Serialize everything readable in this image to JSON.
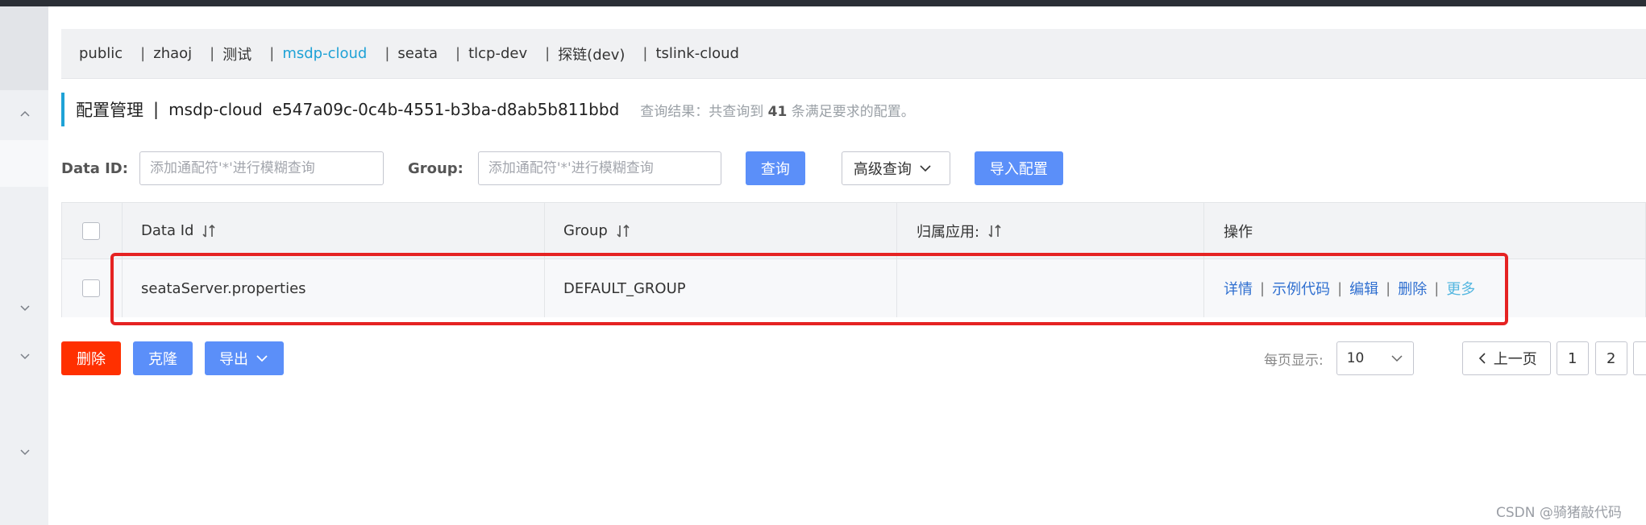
{
  "namespaces": [
    {
      "label": "public",
      "active": false
    },
    {
      "label": "zhaoj",
      "active": false
    },
    {
      "label": "测试",
      "active": false
    },
    {
      "label": "msdp-cloud",
      "active": true
    },
    {
      "label": "seata",
      "active": false
    },
    {
      "label": "tlcp-dev",
      "active": false
    },
    {
      "label": "探链(dev)",
      "active": false
    },
    {
      "label": "tslink-cloud",
      "active": false
    }
  ],
  "namespace_separator": "|",
  "header": {
    "title": "配置管理",
    "separator": "|",
    "namespace_name": "msdp-cloud",
    "namespace_id": "e547a09c-0c4b-4551-b3ba-d8ab5b811bbd",
    "result_prefix": "查询结果：共查询到",
    "result_count": "41",
    "result_suffix": "条满足要求的配置。"
  },
  "filters": {
    "data_id_label": "Data ID:",
    "data_id_placeholder": "添加通配符'*'进行模糊查询",
    "group_label": "Group:",
    "group_placeholder": "添加通配符'*'进行模糊查询",
    "query_button": "查询",
    "advanced_button": "高级查询",
    "import_button": "导入配置"
  },
  "table": {
    "columns": [
      "Data Id",
      "Group",
      "归属应用:",
      "操作"
    ],
    "rows": [
      {
        "data_id": "seataServer.properties",
        "group": "DEFAULT_GROUP",
        "app": "",
        "actions": [
          "详情",
          "示例代码",
          "编辑",
          "删除",
          "更多"
        ]
      }
    ],
    "action_separator": "|"
  },
  "bottom": {
    "delete_button": "删除",
    "clone_button": "克隆",
    "export_button": "导出"
  },
  "pagination": {
    "page_size_label": "每页显示:",
    "page_size": "10",
    "prev_label": "上一页",
    "pages": [
      "1",
      "2"
    ]
  },
  "watermark": "CSDN @骑猪敲代码",
  "colors": {
    "accent": "#1fa2d6",
    "primary_button": "#5b8ff9",
    "danger_button": "#ff3000",
    "highlight_box": "#e52222",
    "link": "#2f6fd0"
  },
  "icons": {
    "sort": "sort-arrows-icon",
    "dropdown": "chevron-down-icon",
    "prev": "chevron-left-icon"
  }
}
